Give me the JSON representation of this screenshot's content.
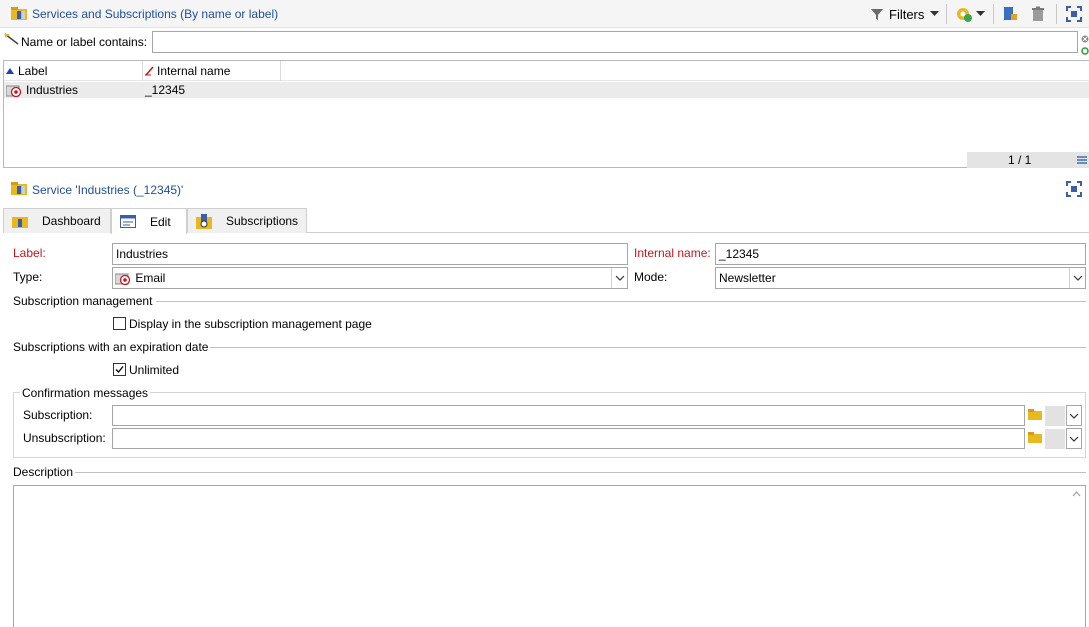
{
  "window": {
    "title": "Services and Subscriptions (By name or label)",
    "filters_label": "Filters"
  },
  "filter": {
    "label": "Name or label contains:",
    "value": ""
  },
  "list": {
    "columns": [
      {
        "label": "Label",
        "sort": "ascending"
      },
      {
        "label": "Internal name"
      }
    ],
    "rows": [
      {
        "label": "Industries",
        "internal_name": "_12345"
      }
    ],
    "pagination": "1 / 1"
  },
  "detail": {
    "title": "Service 'Industries (_12345)'",
    "tabs": [
      {
        "label": "Dashboard",
        "active": false
      },
      {
        "label": "Edit",
        "active": true
      },
      {
        "label": "Subscriptions",
        "active": false
      }
    ]
  },
  "form": {
    "label_label": "Label:",
    "label_value": "Industries",
    "internal_name_label": "Internal name:",
    "internal_name_value": "_12345",
    "type_label": "Type:",
    "type_value": "Email",
    "mode_label": "Mode:",
    "mode_value": "Newsletter",
    "subscription_mgmt_section": "Subscription management",
    "display_in_page_label": "Display in the subscription management page",
    "display_in_page_checked": false,
    "expiration_section": "Subscriptions with an expiration date",
    "unlimited_label": "Unlimited",
    "unlimited_checked": true,
    "confirmation_section": "Confirmation messages",
    "subscription_label": "Subscription:",
    "subscription_value": "",
    "unsubscription_label": "Unsubscription:",
    "unsubscription_value": "",
    "description_section": "Description",
    "description_value": ""
  },
  "colors": {
    "link_blue": "#1f4fa0",
    "required_red": "#c4161c",
    "folder_yellow": "#e8b820"
  }
}
